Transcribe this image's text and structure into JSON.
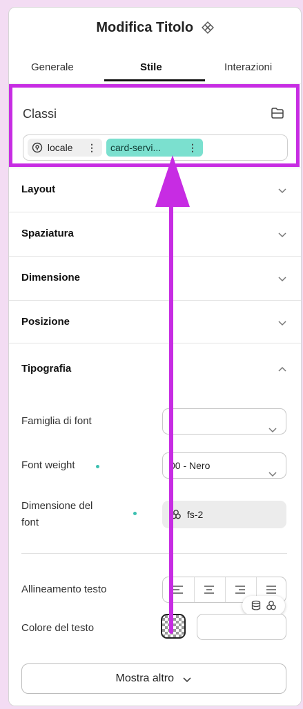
{
  "header": {
    "title": "Modifica Titolo",
    "title_icon": "component-icon",
    "tabs": [
      {
        "label": "Generale",
        "active": false
      },
      {
        "label": "Stile",
        "active": true
      },
      {
        "label": "Interazioni",
        "active": false
      }
    ]
  },
  "classes": {
    "label": "Classi",
    "action_icon": "folder-icon",
    "chips": [
      {
        "label": "locale",
        "icon": "location-pin-icon",
        "menu": "⋮"
      },
      {
        "label": "card-servi...",
        "menu": "⋮"
      }
    ]
  },
  "sections": [
    {
      "label": "Layout",
      "expanded": false
    },
    {
      "label": "Spaziatura",
      "expanded": false
    },
    {
      "label": "Dimensione",
      "expanded": false
    },
    {
      "label": "Posizione",
      "expanded": false
    },
    {
      "label": "Tipografia",
      "expanded": true
    }
  ],
  "typography": {
    "font_family": {
      "label": "Famiglia di font",
      "value": ""
    },
    "font_weight": {
      "label": "Font weight",
      "value": "00 - Nero"
    },
    "font_size": {
      "label_line1": "Dimensione del",
      "label_line2": "font",
      "value": "fs-2"
    },
    "text_align": {
      "label": "Allineamento testo",
      "options": [
        "left",
        "center",
        "right",
        "justify"
      ]
    },
    "text_color": {
      "label": "Colore del testo",
      "value": ""
    },
    "more_button": "Mostra altro"
  },
  "colors": {
    "highlight": "#c72ce3",
    "chip_accent": "#7be0cf",
    "indicator_dot": "#3cc0b0"
  }
}
